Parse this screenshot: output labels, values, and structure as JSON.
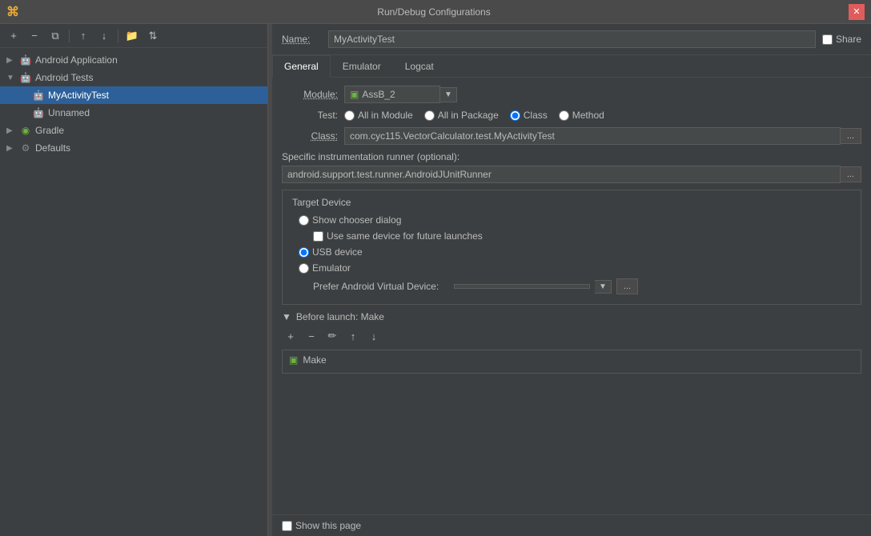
{
  "window": {
    "title": "Run/Debug Configurations",
    "logo": "⌘"
  },
  "toolbar": {
    "add": "+",
    "remove": "−",
    "copy": "⧉",
    "moveUp": "↑",
    "moveDown": "↓",
    "folder": "📁",
    "sort": "⇅"
  },
  "tree": {
    "items": [
      {
        "id": "android-app",
        "label": "Android Application",
        "level": 1,
        "type": "android",
        "arrow": "▼"
      },
      {
        "id": "android-tests",
        "label": "Android Tests",
        "level": 1,
        "type": "android",
        "arrow": "▼"
      },
      {
        "id": "my-activity-test",
        "label": "MyActivityTest",
        "level": 2,
        "type": "android",
        "arrow": "",
        "selected": true
      },
      {
        "id": "unnamed",
        "label": "Unnamed",
        "level": 2,
        "type": "android",
        "arrow": ""
      },
      {
        "id": "gradle",
        "label": "Gradle",
        "level": 1,
        "type": "gradle",
        "arrow": "▶"
      },
      {
        "id": "defaults",
        "label": "Defaults",
        "level": 1,
        "type": "defaults",
        "arrow": "▶"
      }
    ]
  },
  "form": {
    "name_label": "Name:",
    "name_value": "MyActivityTest",
    "share_label": "Share",
    "tabs": [
      "General",
      "Emulator",
      "Logcat"
    ],
    "active_tab": "General",
    "module_label": "Module:",
    "module_value": "AssB_2",
    "test_label": "Test:",
    "test_options": [
      "All in Module",
      "All in Package",
      "Class",
      "Method"
    ],
    "test_selected": "Class",
    "class_label": "Class:",
    "class_value": "com.cyc115.VectorCalculator.test.MyActivityTest",
    "instrumentation_label": "Specific instrumentation runner (optional):",
    "instrumentation_value": "android.support.test.runner.AndroidJUnitRunner",
    "target_device": {
      "title": "Target Device",
      "options": [
        {
          "id": "show-chooser",
          "label": "Show chooser dialog"
        },
        {
          "id": "usb",
          "label": "USB device",
          "selected": true
        },
        {
          "id": "emulator",
          "label": "Emulator"
        }
      ],
      "same_device_label": "Use same device for future launches",
      "avd_label": "Prefer Android Virtual Device:",
      "avd_value": ""
    },
    "before_launch": {
      "title": "Before launch: Make",
      "items": [
        "Make"
      ],
      "toolbar": [
        "+",
        "−",
        "✏",
        "↑",
        "↓"
      ]
    },
    "show_page_label": "Show this page"
  }
}
